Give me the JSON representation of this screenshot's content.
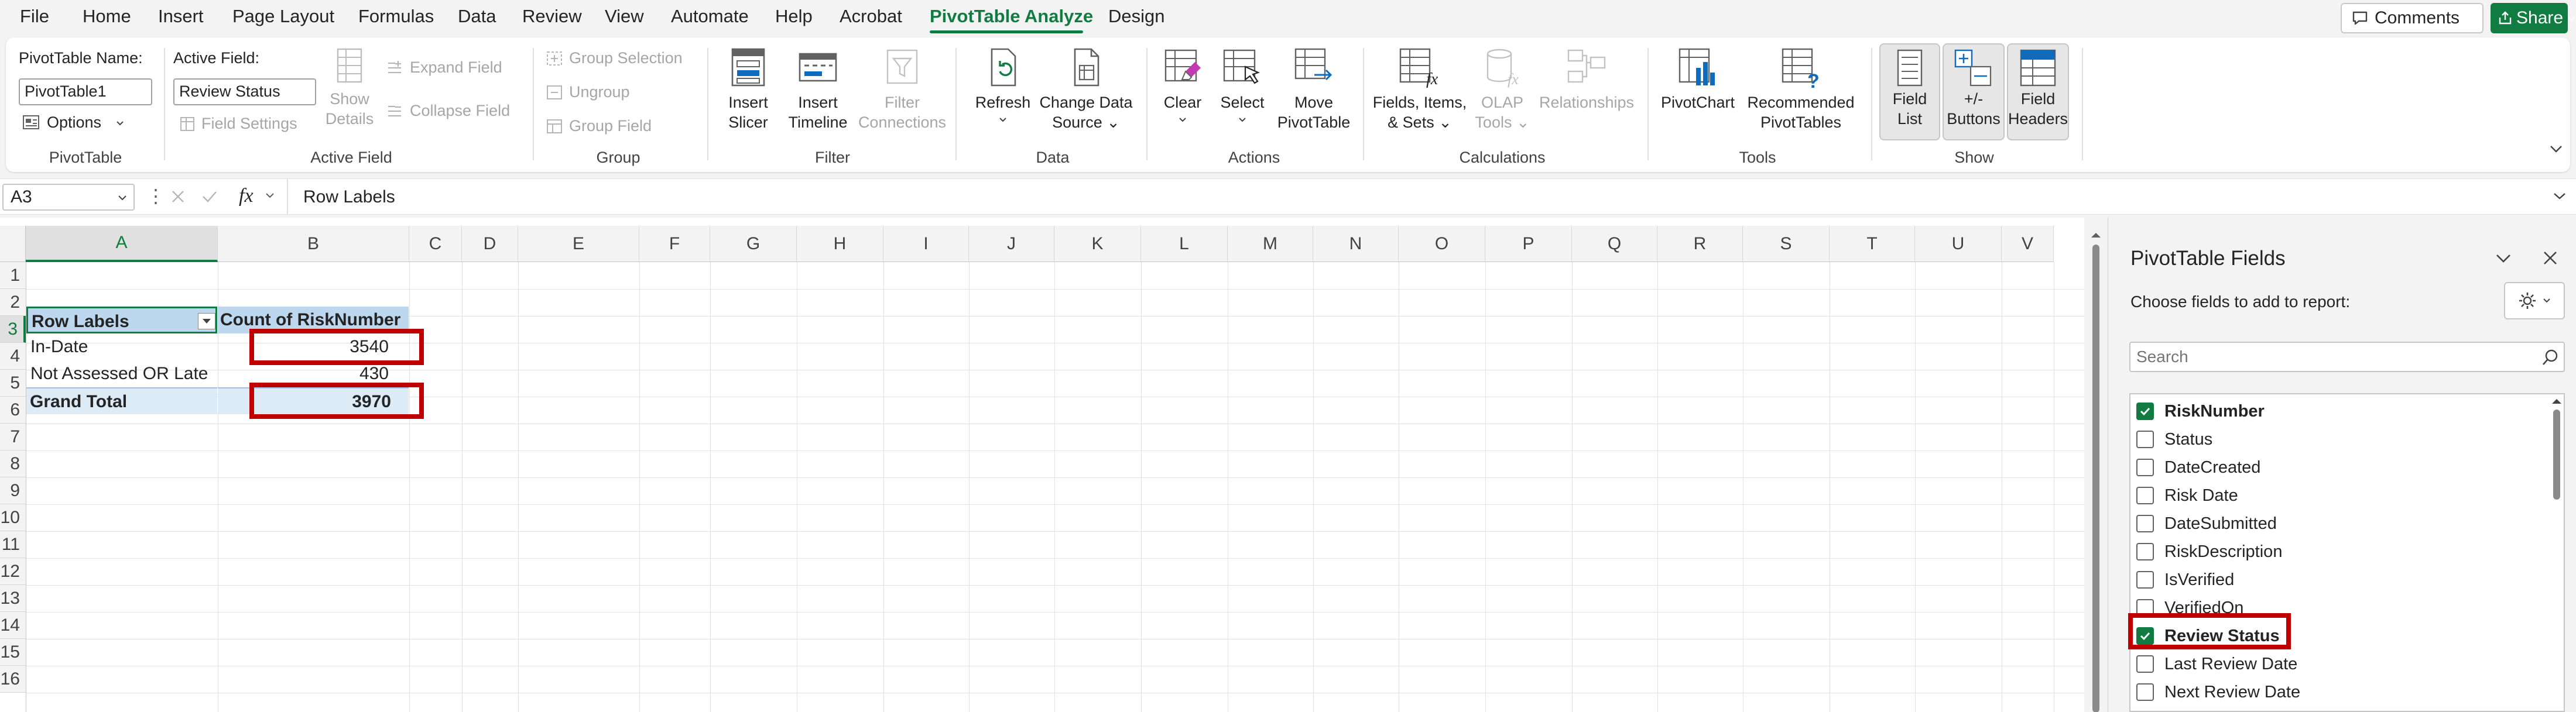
{
  "menu": {
    "tabs": [
      {
        "label": "File"
      },
      {
        "label": "Home"
      },
      {
        "label": "Insert"
      },
      {
        "label": "Page Layout"
      },
      {
        "label": "Formulas"
      },
      {
        "label": "Data"
      },
      {
        "label": "Review"
      },
      {
        "label": "View"
      },
      {
        "label": "Automate"
      },
      {
        "label": "Help"
      },
      {
        "label": "Acrobat"
      },
      {
        "label": "PivotTable Analyze"
      },
      {
        "label": "Design"
      }
    ],
    "active_tab": "PivotTable Analyze",
    "comments_label": "Comments",
    "share_label": "Share"
  },
  "ribbon": {
    "pivottable": {
      "name_label": "PivotTable Name:",
      "name_value": "PivotTable1",
      "options_label": "Options",
      "group_label": "PivotTable"
    },
    "active_field": {
      "label": "Active Field:",
      "value": "Review Status",
      "field_settings": "Field Settings",
      "show_details_1": "Show",
      "show_details_2": "Details",
      "expand_field": "Expand Field",
      "collapse_field": "Collapse Field",
      "group_label": "Active Field"
    },
    "group": {
      "group_selection": "Group Selection",
      "ungroup": "Ungroup",
      "group_field": "Group Field",
      "group_label": "Group"
    },
    "filter": {
      "insert_slicer_1": "Insert",
      "insert_slicer_2": "Slicer",
      "insert_timeline_1": "Insert",
      "insert_timeline_2": "Timeline",
      "filter_connections_1": "Filter",
      "filter_connections_2": "Connections",
      "group_label": "Filter"
    },
    "data": {
      "refresh": "Refresh",
      "change_source_1": "Change Data",
      "change_source_2": "Source",
      "group_label": "Data"
    },
    "actions": {
      "clear": "Clear",
      "select": "Select",
      "move_1": "Move",
      "move_2": "PivotTable",
      "group_label": "Actions"
    },
    "calculations": {
      "fields_items_1": "Fields, Items,",
      "fields_items_2": "& Sets",
      "olap_1": "OLAP",
      "olap_2": "Tools",
      "relationships": "Relationships",
      "group_label": "Calculations"
    },
    "tools": {
      "pivotchart": "PivotChart",
      "recommended_1": "Recommended",
      "recommended_2": "PivotTables",
      "group_label": "Tools"
    },
    "show": {
      "field_list_1": "Field",
      "field_list_2": "List",
      "buttons_1": "+/-",
      "buttons_2": "Buttons",
      "field_headers_1": "Field",
      "field_headers_2": "Headers",
      "group_label": "Show"
    }
  },
  "formula_bar": {
    "name_box": "A3",
    "fx": "fx",
    "content": "Row Labels"
  },
  "sheet": {
    "columns": [
      "A",
      "B",
      "C",
      "D",
      "E",
      "F",
      "G",
      "H",
      "I",
      "J",
      "K",
      "L",
      "M",
      "N",
      "O",
      "P",
      "Q",
      "R",
      "S",
      "T",
      "U",
      "V"
    ],
    "rows": [
      "1",
      "2",
      "3",
      "4",
      "5",
      "6",
      "7",
      "8",
      "9",
      "10",
      "11",
      "12",
      "13",
      "14",
      "15",
      "16"
    ],
    "pivot": {
      "header_row_labels": "Row Labels",
      "header_count": "Count of RiskNumber",
      "row1_label": "In-Date",
      "row1_value": "3540",
      "row2_label": "Not Assessed OR Late",
      "row2_value": "430",
      "total_label": "Grand Total",
      "total_value": "3970"
    }
  },
  "pane": {
    "title": "PivotTable Fields",
    "subtitle": "Choose fields to add to report:",
    "search_placeholder": "Search",
    "fields": [
      {
        "name": "RiskNumber",
        "checked": true
      },
      {
        "name": "Status",
        "checked": false
      },
      {
        "name": "DateCreated",
        "checked": false
      },
      {
        "name": "Risk Date",
        "checked": false
      },
      {
        "name": "DateSubmitted",
        "checked": false
      },
      {
        "name": "RiskDescription",
        "checked": false
      },
      {
        "name": "IsVerified",
        "checked": false
      },
      {
        "name": "VerifiedOn",
        "checked": false
      },
      {
        "name": "Review Status",
        "checked": true
      },
      {
        "name": "Last Review Date",
        "checked": false
      },
      {
        "name": "Next Review Date",
        "checked": false
      }
    ]
  },
  "colors": {
    "accent_green": "#107c41",
    "highlight_red": "#c00000",
    "pivot_header_blue": "#bdd7ee",
    "pivot_total_blue": "#ddebf7"
  }
}
